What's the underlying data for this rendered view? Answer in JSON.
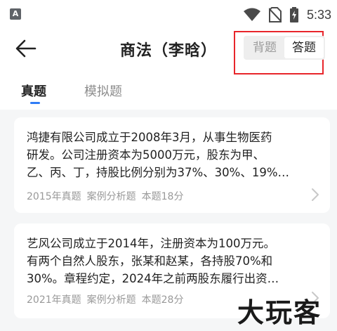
{
  "status_bar": {
    "app_icon_letter": "A",
    "time": "5:33",
    "icons": [
      "wifi-icon",
      "no-sim-icon",
      "battery-charging-icon"
    ]
  },
  "header": {
    "title": "商法（李晗）",
    "mode_toggle": {
      "options": [
        "背题",
        "答题"
      ],
      "selected": "答题"
    }
  },
  "tabs": [
    {
      "label": "真题",
      "active": true
    },
    {
      "label": "模拟题",
      "active": false
    }
  ],
  "cards": [
    {
      "lines": [
        "鸿捷有限公司成立于2008年3月，从事生物医药",
        "研发。公司注册资本为5000万元，股东为甲、",
        "乙、丙、丁，持股比例分别为37%、30%、19%…"
      ],
      "year": "2015年真题",
      "type": "案例分析题",
      "score": "本题18分"
    },
    {
      "lines": [
        "艺风公司成立于2014年，注册资本为100万元。",
        "有两个自然人股东，张某和赵某，各持股70%和",
        "30%。章程约定，2024年之前两股东履行出资…"
      ],
      "year": "2021年真题",
      "type": "案例分析题",
      "score": "本题28分"
    }
  ],
  "watermark": "大玩客",
  "colors": {
    "accent": "#2f7cf6",
    "highlight_box": "#e8252b",
    "background": "#f5f6f7"
  }
}
